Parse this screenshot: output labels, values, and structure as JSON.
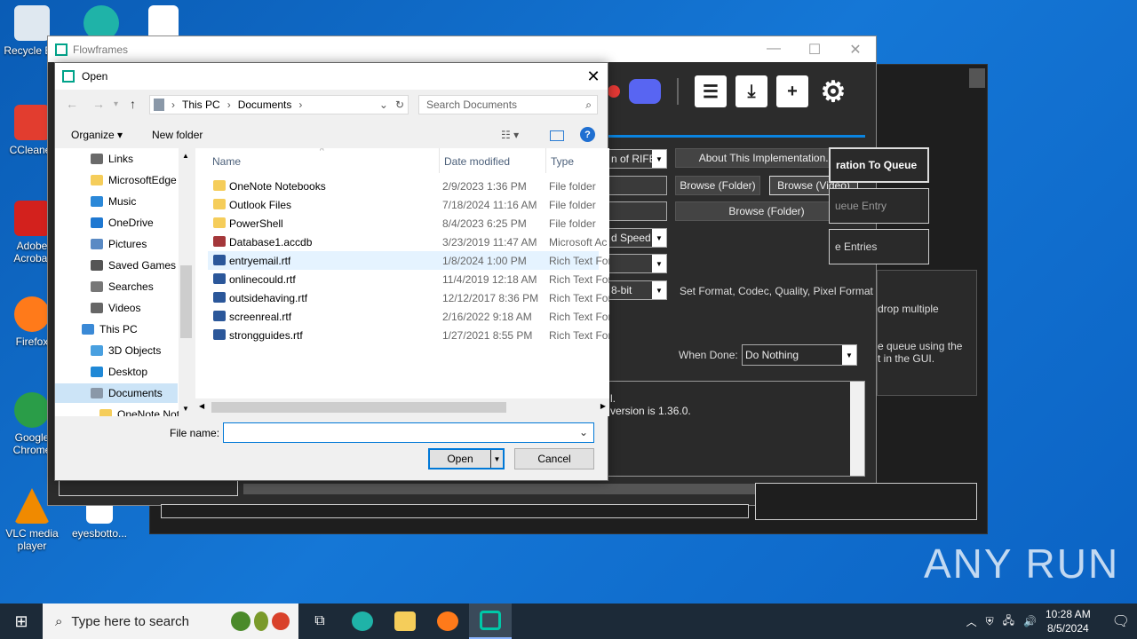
{
  "desktop": {
    "icons": [
      {
        "label": "Recycle Bin",
        "color": "#dfe8f0"
      },
      {
        "label": "CCleaner",
        "color": "#e23d2f"
      },
      {
        "label": "Adobe Acrobat",
        "color": "#d3211d"
      },
      {
        "label": "Firefox",
        "color": "#ff7a1a"
      },
      {
        "label": "Google Chrome",
        "color": "#2a9d48"
      },
      {
        "label": "VLC media player",
        "color": "#f08a00"
      },
      {
        "label": "eyesbotto...",
        "color": "#ffffff"
      }
    ],
    "watermark": "ANY RUN"
  },
  "flowframes": {
    "title": "Flowframes",
    "buttons": {
      "about": "About This Implementation...",
      "browse_folder_1": "Browse (Folder)",
      "browse_video": "Browse (Video)",
      "browse_folder_2": "Browse (Folder)",
      "add_queue": "ration To Queue",
      "queue_entry": "ueue Entry",
      "entries": "e Entries"
    },
    "selects": {
      "ai": "n of RIFE",
      "speed": "d Speed",
      "bit": "8-bit",
      "when_done": "Do Nothing"
    },
    "labels": {
      "set_format": "Set Format, Codec, Quality, Pixel Format",
      "when_done": "When Done:",
      "drop": "drop multiple",
      "queue_gui": "e queue using the\nt in the GUI."
    },
    "log": {
      "line1": "l.",
      "line2": "version is 1.36.0."
    },
    "toolbar_icons": [
      "record-icon",
      "discord-icon",
      "list-icon",
      "download-icon",
      "add-icon",
      "settings-icon"
    ]
  },
  "dialog": {
    "title": "Open",
    "breadcrumb": [
      "This PC",
      "Documents"
    ],
    "search_placeholder": "Search Documents",
    "organize": "Organize",
    "new_folder": "New folder",
    "nav_items": [
      {
        "label": "Links",
        "icon": "links-icon",
        "color": "#6a6a6a"
      },
      {
        "label": "MicrosoftEdge",
        "icon": "folder-icon",
        "color": "#f5cd5a"
      },
      {
        "label": "Music",
        "icon": "music-icon",
        "color": "#2b88d8"
      },
      {
        "label": "OneDrive",
        "icon": "cloud-icon",
        "color": "#1e78d1"
      },
      {
        "label": "Pictures",
        "icon": "pictures-icon",
        "color": "#5a8ac4"
      },
      {
        "label": "Saved Games",
        "icon": "games-icon",
        "color": "#555555"
      },
      {
        "label": "Searches",
        "icon": "search-icon",
        "color": "#777777"
      },
      {
        "label": "Videos",
        "icon": "videos-icon",
        "color": "#666666"
      },
      {
        "label": "This PC",
        "icon": "pc-icon",
        "color": "#3a89d6"
      },
      {
        "label": "3D Objects",
        "icon": "cube-icon",
        "color": "#49a0e0"
      },
      {
        "label": "Desktop",
        "icon": "desktop-icon",
        "color": "#1f88d6"
      },
      {
        "label": "Documents",
        "icon": "documents-icon",
        "color": "#8a98a8"
      },
      {
        "label": "OneNote Not",
        "icon": "folder-icon",
        "color": "#f5cd5a"
      }
    ],
    "columns": {
      "name": "Name",
      "date": "Date modified",
      "type": "Type"
    },
    "files": [
      {
        "name": "OneNote Notebooks",
        "date": "2/9/2023 1:36 PM",
        "type": "File folder",
        "color": "#f5cd5a"
      },
      {
        "name": "Outlook Files",
        "date": "7/18/2024 11:16 AM",
        "type": "File folder",
        "color": "#f5cd5a"
      },
      {
        "name": "PowerShell",
        "date": "8/4/2023 6:25 PM",
        "type": "File folder",
        "color": "#f5cd5a"
      },
      {
        "name": "Database1.accdb",
        "date": "3/23/2019 11:47 AM",
        "type": "Microsoft Ac",
        "color": "#a4373a"
      },
      {
        "name": "entryemail.rtf",
        "date": "1/8/2024 1:00 PM",
        "type": "Rich Text For",
        "color": "#2b579a"
      },
      {
        "name": "onlinecould.rtf",
        "date": "11/4/2019 12:18 AM",
        "type": "Rich Text For",
        "color": "#2b579a"
      },
      {
        "name": "outsidehaving.rtf",
        "date": "12/12/2017 8:36 PM",
        "type": "Rich Text For",
        "color": "#2b579a"
      },
      {
        "name": "screenreal.rtf",
        "date": "2/16/2022 9:18 AM",
        "type": "Rich Text For",
        "color": "#2b579a"
      },
      {
        "name": "strongguides.rtf",
        "date": "1/27/2021 8:55 PM",
        "type": "Rich Text For",
        "color": "#2b579a"
      }
    ],
    "filename_label": "File name:",
    "filename_value": "",
    "open_button": "Open",
    "cancel_button": "Cancel"
  },
  "taskbar": {
    "search_placeholder": "Type here to search",
    "time": "10:28 AM",
    "date": "8/5/2024"
  }
}
